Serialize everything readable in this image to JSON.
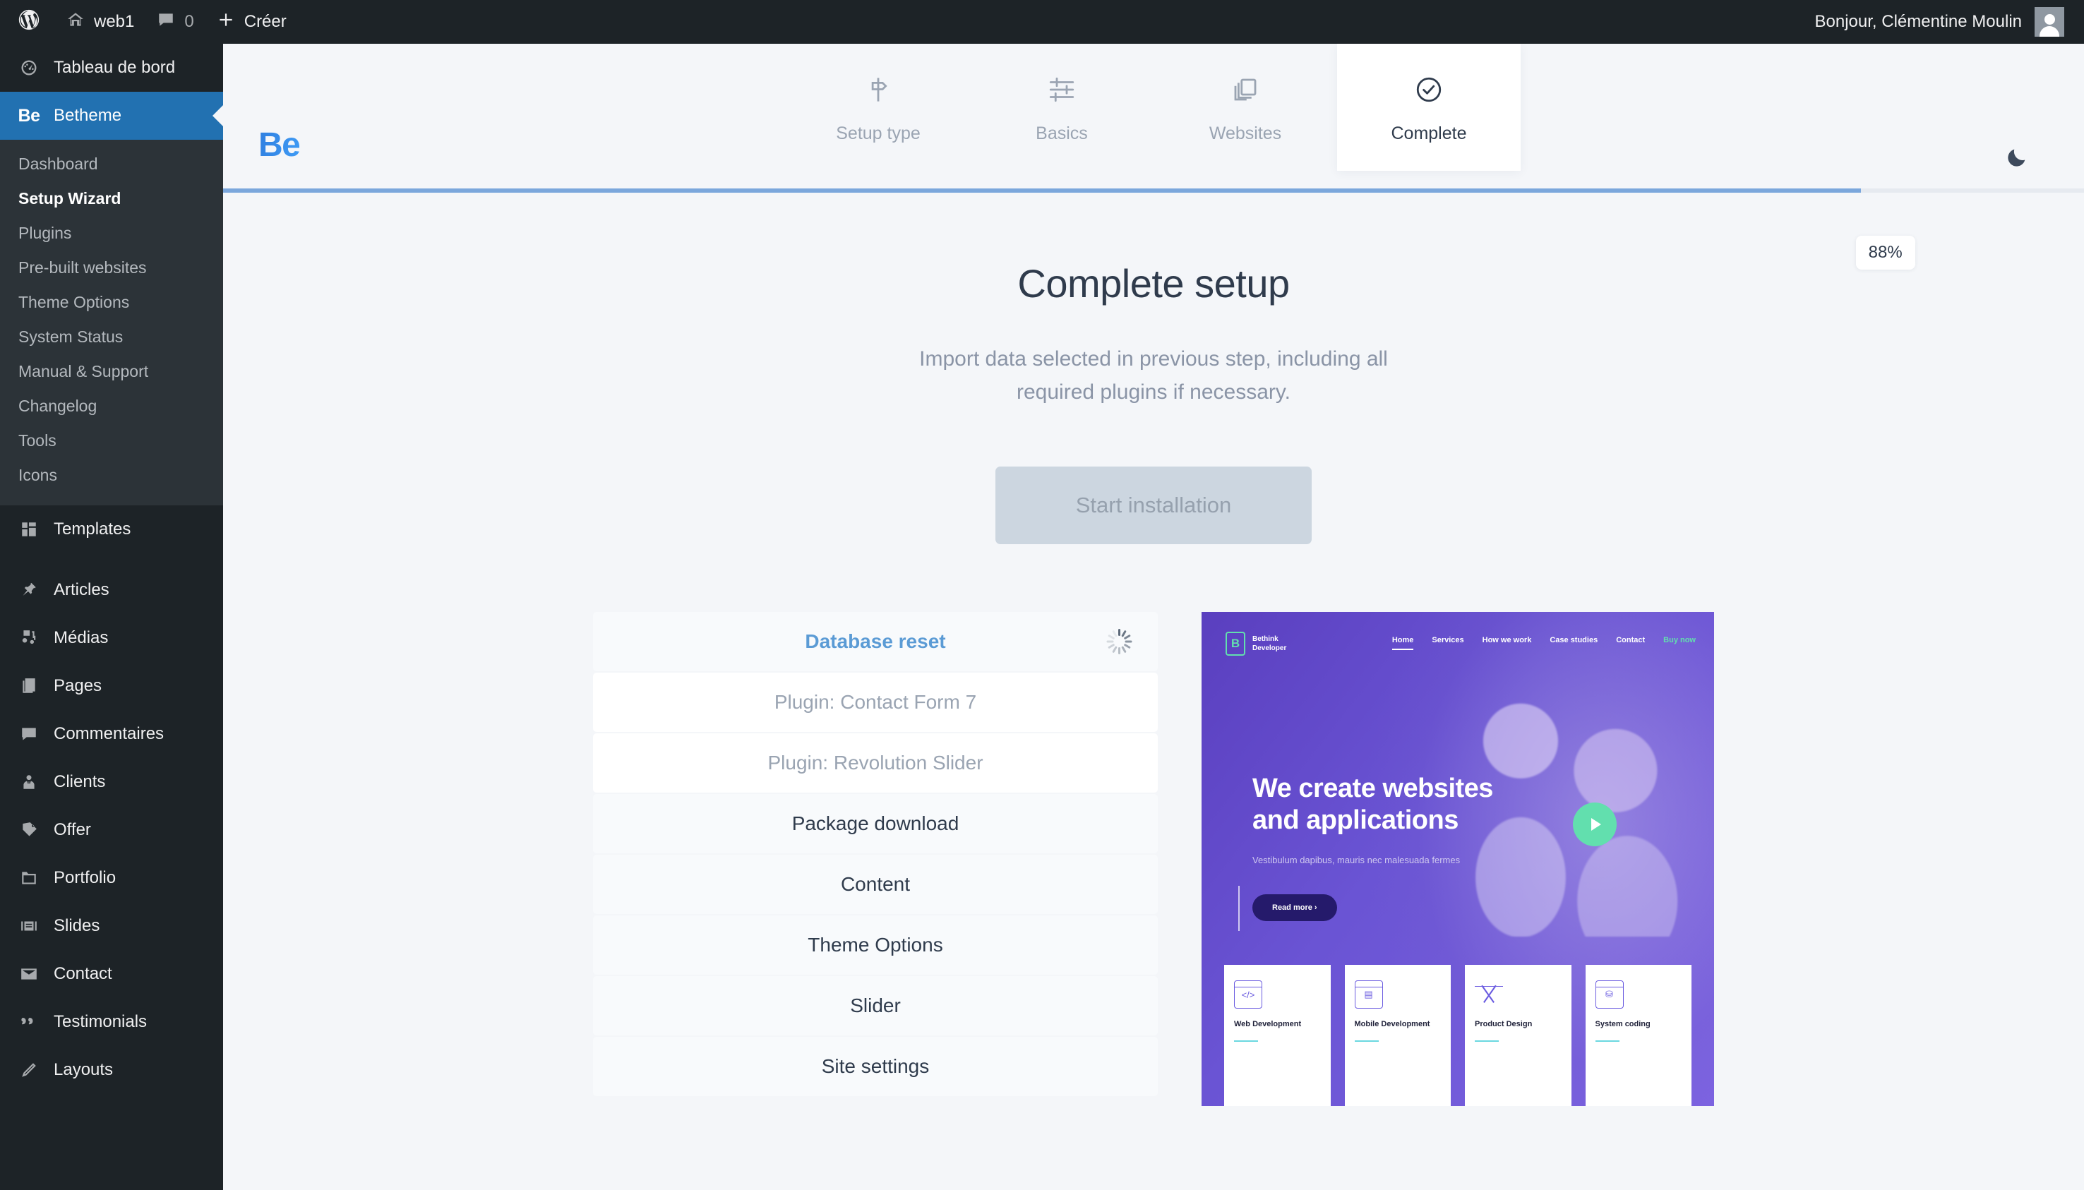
{
  "adminbar": {
    "wp_logo_icon": "wordpress-icon",
    "site_icon": "home-icon",
    "site_name": "web1",
    "comments_icon": "comment-bubble-icon",
    "comments_count": "0",
    "new_icon": "plus-icon",
    "new_label": "Créer",
    "greeting": "Bonjour, Clémentine Moulin",
    "avatar_icon": "avatar-icon"
  },
  "sidebar": {
    "dashboard": {
      "label": "Tableau de bord",
      "icon": "dashboard-gauge-icon"
    },
    "betheme": {
      "label": "Betheme",
      "badge": "Be",
      "icon": "be-logo-icon"
    },
    "betheme_submenu": [
      {
        "label": "Dashboard",
        "current": false
      },
      {
        "label": "Setup Wizard",
        "current": true
      },
      {
        "label": "Plugins",
        "current": false
      },
      {
        "label": "Pre-built websites",
        "current": false
      },
      {
        "label": "Theme Options",
        "current": false
      },
      {
        "label": "System Status",
        "current": false
      },
      {
        "label": "Manual & Support",
        "current": false
      },
      {
        "label": "Changelog",
        "current": false
      },
      {
        "label": "Tools",
        "current": false
      },
      {
        "label": "Icons",
        "current": false
      }
    ],
    "items": [
      {
        "label": "Templates",
        "icon": "templates-grid-icon"
      },
      {
        "label": "Articles",
        "icon": "pin-icon"
      },
      {
        "label": "Médias",
        "icon": "media-icon"
      },
      {
        "label": "Pages",
        "icon": "pages-icon"
      },
      {
        "label": "Commentaires",
        "icon": "comment-bubble-icon"
      },
      {
        "label": "Clients",
        "icon": "user-tie-icon"
      },
      {
        "label": "Offer",
        "icon": "tag-icon"
      },
      {
        "label": "Portfolio",
        "icon": "folder-icon"
      },
      {
        "label": "Slides",
        "icon": "slides-icon"
      },
      {
        "label": "Contact",
        "icon": "envelope-icon"
      },
      {
        "label": "Testimonials",
        "icon": "quote-icon"
      },
      {
        "label": "Layouts",
        "icon": "pencil-icon"
      }
    ]
  },
  "wizard": {
    "logo_text": "Be",
    "steps": [
      {
        "label": "Setup type",
        "icon": "signpost-icon",
        "active": false
      },
      {
        "label": "Basics",
        "icon": "sliders-icon",
        "active": false
      },
      {
        "label": "Websites",
        "icon": "layers-icon",
        "active": false
      },
      {
        "label": "Complete",
        "icon": "check-circle-icon",
        "active": true
      }
    ],
    "darkmode_icon": "moon-icon",
    "progress_percent": 88,
    "progress_label": "88%",
    "title": "Complete setup",
    "subtitle": "Import data selected in previous step, including all required plugins if necessary.",
    "start_button": "Start installation",
    "tasks": [
      {
        "label": "Database reset",
        "state": "active",
        "spinner": true
      },
      {
        "label": "Plugin: Contact Form 7",
        "state": "pending",
        "spinner": false
      },
      {
        "label": "Plugin: Revolution Slider",
        "state": "pending",
        "spinner": false
      },
      {
        "label": "Package download",
        "state": "queued",
        "spinner": false
      },
      {
        "label": "Content",
        "state": "queued",
        "spinner": false
      },
      {
        "label": "Theme Options",
        "state": "queued",
        "spinner": false
      },
      {
        "label": "Slider",
        "state": "queued",
        "spinner": false
      },
      {
        "label": "Site settings",
        "state": "queued",
        "spinner": false
      }
    ]
  },
  "preview": {
    "logo_mark": "B",
    "logo_line1": "Bethink",
    "logo_line2": "Developer",
    "nav": [
      "Home",
      "Services",
      "How we work",
      "Case studies",
      "Contact",
      "Buy now"
    ],
    "headline_line1": "We create websites",
    "headline_line2": "and applications",
    "subtitle": "Vestibulum dapibus, mauris nec malesuada fermes",
    "button": "Read more ›",
    "play_icon": "play-icon",
    "cards": [
      {
        "title": "Web Development",
        "icon": "code-window-icon"
      },
      {
        "title": "Mobile Development",
        "icon": "mobile-screen-icon"
      },
      {
        "title": "Product Design",
        "icon": "pencil-ruler-icon"
      },
      {
        "title": "System coding",
        "icon": "sitemap-window-icon"
      }
    ]
  },
  "colors": {
    "admin_dark": "#1d2327",
    "submenu_dark": "#2c3338",
    "wp_blue": "#2271b1",
    "accent_blue": "#5b9bd5",
    "page_bg": "#f4f6f9",
    "preview_purple": "#5b4fc9",
    "preview_green": "#62dfae"
  }
}
